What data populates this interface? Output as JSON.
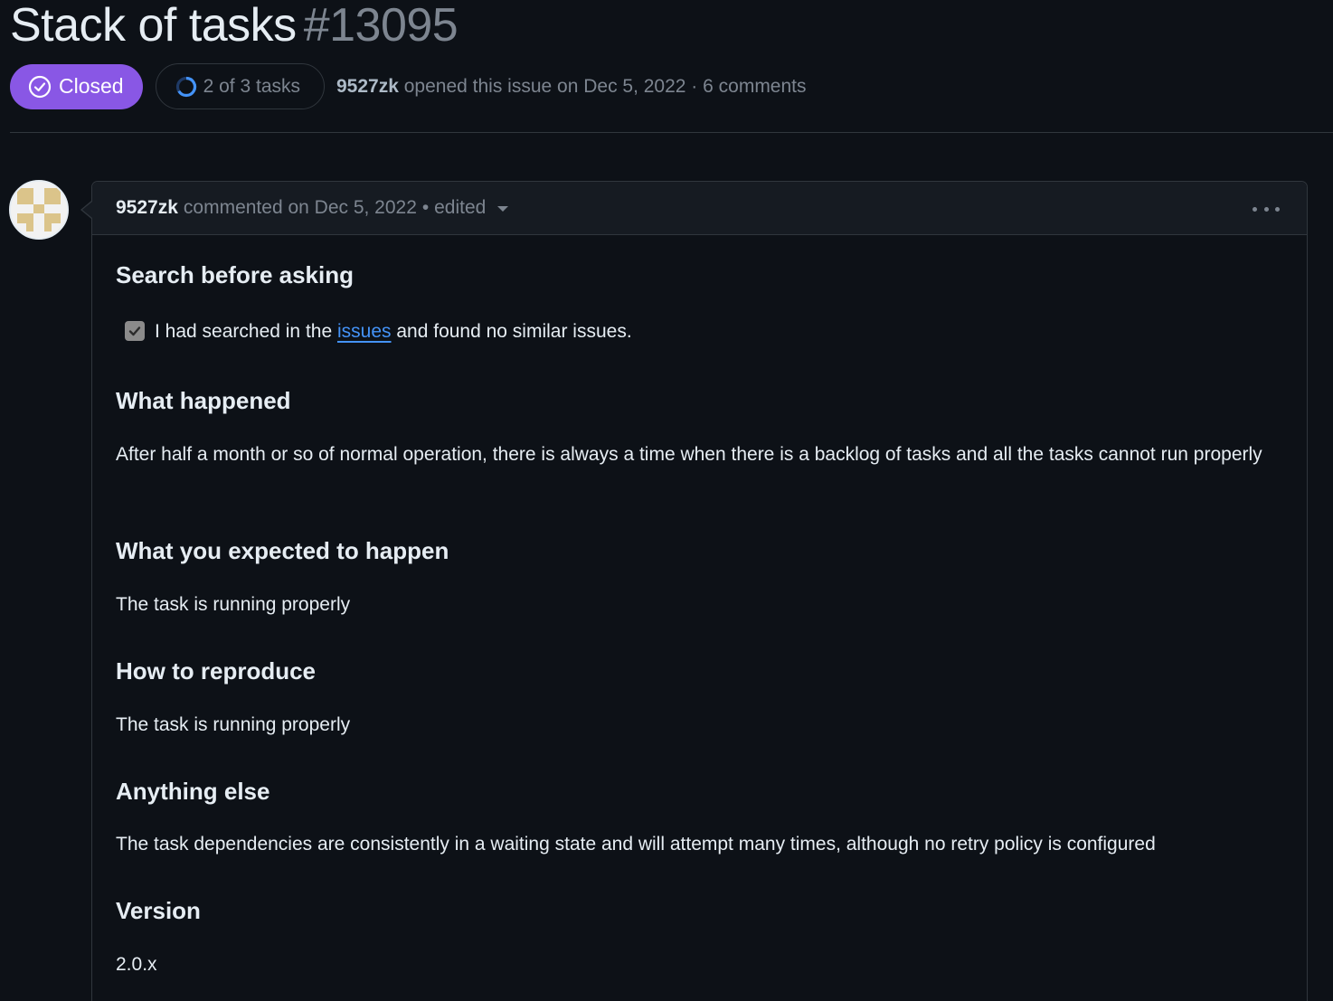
{
  "issue": {
    "title": "Stack of tasks",
    "number": "#13095",
    "state_label": "Closed",
    "tasks_label": "2 of 3 tasks",
    "author": "9527zk",
    "opened_text": "opened this issue on Dec 5, 2022 · 6 comments"
  },
  "comment": {
    "author": "9527zk",
    "commented_text": "commented on Dec 5, 2022",
    "edited_text": "• edited"
  },
  "body": {
    "search_heading": "Search before asking",
    "checkbox_checked": true,
    "checkbox_text_before": "I had searched in the",
    "checkbox_link": "issues",
    "checkbox_text_after": "and found no similar issues.",
    "what_happened_heading": "What happened",
    "what_happened_text": "After half a month or so of normal operation, there is always a time when there is a backlog of tasks and all the tasks cannot run properly",
    "expected_heading": "What you expected to happen",
    "expected_text": "The task is running properly",
    "reproduce_heading": "How to reproduce",
    "reproduce_text": "The task is running properly",
    "anything_else_heading": "Anything else",
    "anything_else_text": "The task dependencies are consistently in a waiting state and will attempt many times, although no retry policy is configured",
    "version_heading": "Version",
    "version_text": "2.0.x"
  },
  "icons": {
    "state": "check-circle-icon",
    "tasks": "progress-ring-icon",
    "caret": "caret-down-icon",
    "menu": "kebab-horizontal-icon",
    "checkbox": "checkbox-icon"
  },
  "colors": {
    "background": "#0d1117",
    "closed_badge": "#8957e5",
    "link": "#4493f8",
    "muted_text": "#7d8590",
    "border": "#30363d",
    "progress_ring": "#4493f8"
  }
}
